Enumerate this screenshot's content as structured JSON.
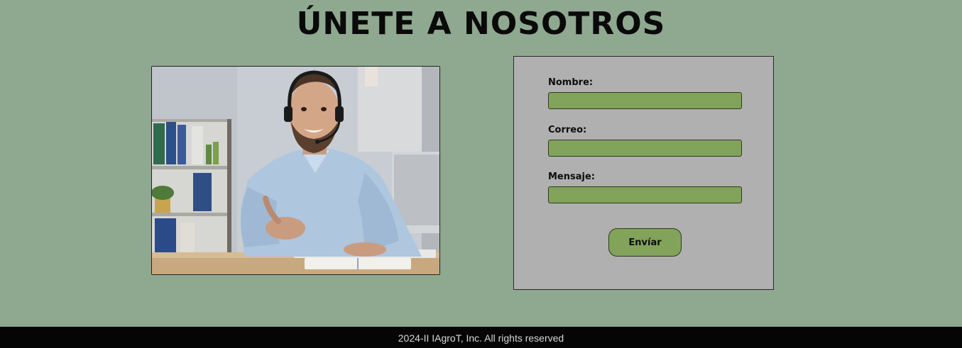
{
  "header": {
    "title": "ÚNETE A NOSOTROS"
  },
  "image": {
    "icon": "person-with-headset-photo"
  },
  "form": {
    "fields": [
      {
        "label": "Nombre:",
        "value": "",
        "placeholder": ""
      },
      {
        "label": "Correo:",
        "value": "",
        "placeholder": ""
      },
      {
        "label": "Mensaje:",
        "value": "",
        "placeholder": ""
      }
    ],
    "submit_label": "Envíar"
  },
  "footer": {
    "text": "2024-II IAgroT, Inc. All rights reserved"
  },
  "colors": {
    "page_background": "#8fa890",
    "form_background": "#b0b0b0",
    "accent_green": "#82a35a",
    "footer_background": "#050505"
  }
}
